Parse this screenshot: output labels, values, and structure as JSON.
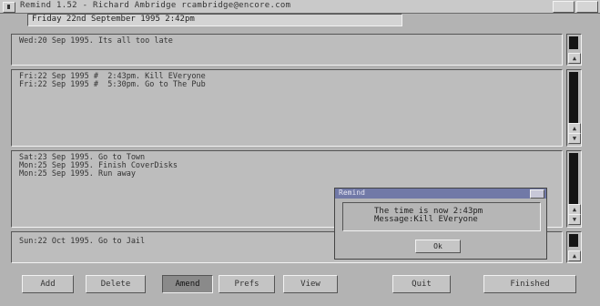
{
  "window": {
    "title": "Remind 1.52 - Richard Ambridge rcambridge@encore.com"
  },
  "date_field": {
    "value": "Friday 22nd September 1995  2:42pm"
  },
  "panels": [
    {
      "lines": [
        "Wed:20 Sep 1995. Its all too late"
      ]
    },
    {
      "lines": [
        "Fri:22 Sep 1995 #  2:43pm. Kill EVeryone",
        "Fri:22 Sep 1995 #  5:30pm. Go to The Pub"
      ]
    },
    {
      "lines": [
        "Sat:23 Sep 1995. Go to Town",
        "Mon:25 Sep 1995. Finish CoverDisks",
        "Mon:25 Sep 1995. Run away"
      ]
    },
    {
      "lines": [
        "Sun:22 Oct 1995. Go to Jail"
      ]
    }
  ],
  "buttons": {
    "add": "Add",
    "delete": "Delete",
    "amend": "Amend",
    "prefs": "Prefs",
    "view": "View",
    "quit": "Quit",
    "finished": "Finished"
  },
  "dialog": {
    "title": "Remind",
    "line1": "The time is now  2:43pm",
    "line2": "Message:Kill EVeryone",
    "ok": "Ok"
  },
  "colors": {
    "background": "#b3b3b3",
    "dialog_titlebar": "#7179a7",
    "scroll_knob": "#141414"
  }
}
